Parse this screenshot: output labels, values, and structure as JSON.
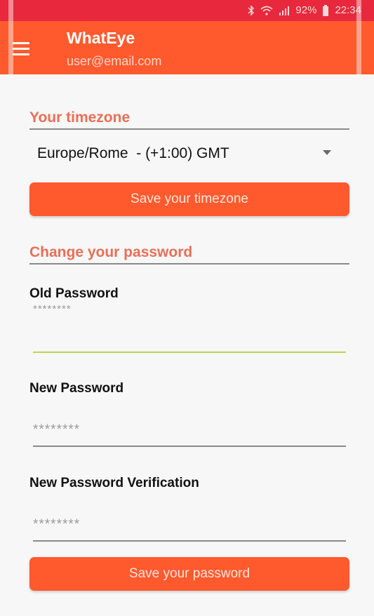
{
  "status_bar": {
    "icons": [
      "bluetooth-icon",
      "wifi-icon",
      "signal-icon",
      "battery-icon"
    ],
    "battery": "92%",
    "time": "22:34"
  },
  "app_bar": {
    "menu_icon": "hamburger-menu-icon",
    "title": "WhatEye",
    "subtitle": "user@email.com"
  },
  "timezone": {
    "section_title": "Your timezone",
    "selected": "Europe/Rome  - (+1:00) GMT",
    "save_label": "Save your timezone"
  },
  "password": {
    "section_title": "Change your password",
    "old": {
      "label": "Old Password",
      "placeholder": "********"
    },
    "new": {
      "label": "New Password",
      "placeholder": "********"
    },
    "verify": {
      "label": "New Password Verification",
      "placeholder": "********"
    },
    "save_label": "Save your password"
  },
  "colors": {
    "accent": "#ff5a2e",
    "status_bar": "#e8283c",
    "section_title": "#e86f58",
    "focus_underline": "#b5d94a"
  }
}
